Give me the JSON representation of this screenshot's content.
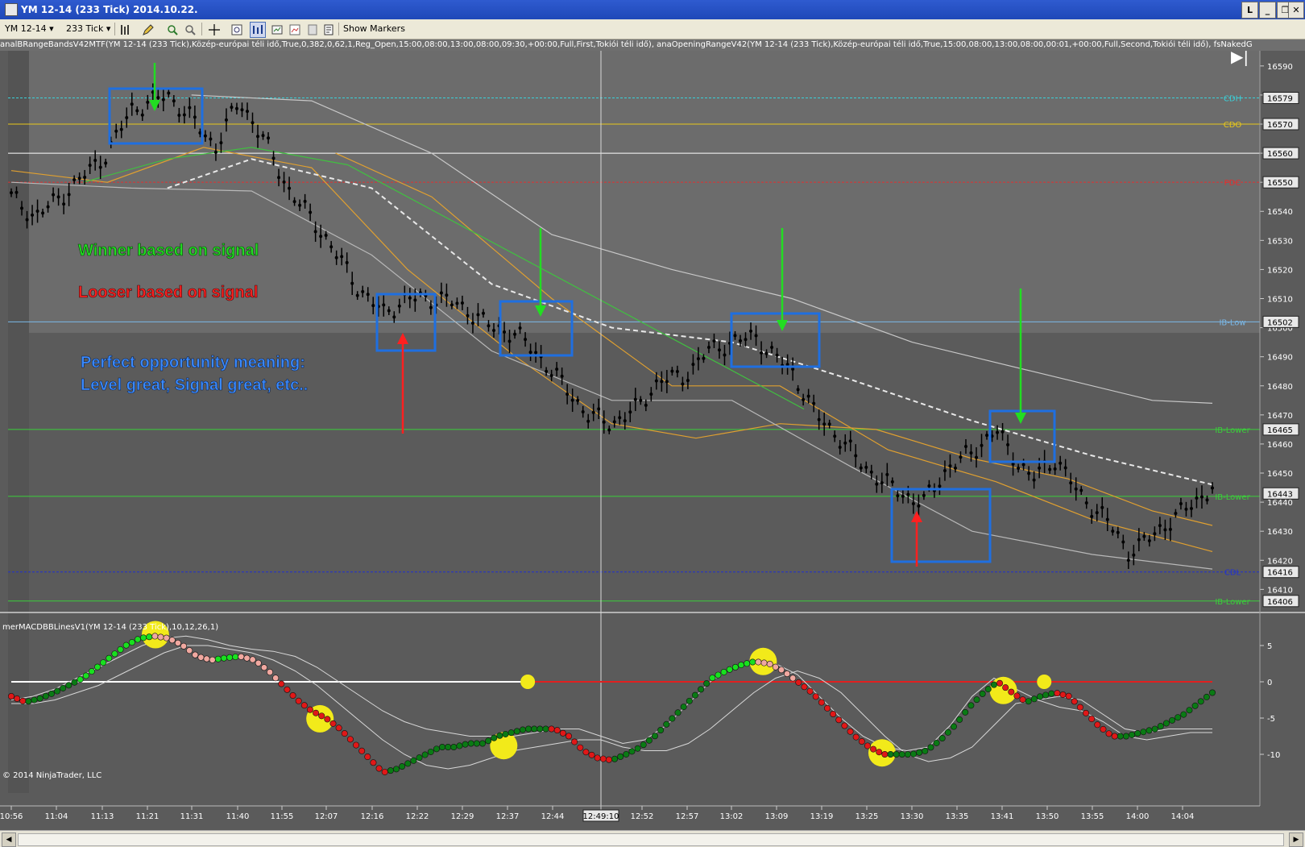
{
  "window": {
    "title": "YM 12-14 (233 Tick)  2014.10.22.",
    "buttons": [
      "L",
      "_",
      "❐",
      "✕"
    ]
  },
  "toolbar": {
    "instrument": "YM 12-14",
    "interval": "233 Tick",
    "show_markers": "Show Markers"
  },
  "indicator_text": "analBRangeBandsV42MTF(YM 12-14 (233 Tick),Közép-európai téli idő,True,0,382,0,62,1,Reg_Open,15:00,08:00,13:00,08:00,09:30,+00:00,Full,First,Tokiói téli idő), anaOpeningRangeV42(YM 12-14 (233 Tick),Közép-európai téli idő,True,15:00,08:00,13:00,08:00,00:01,+00:00,Full,Second,Tokiói téli idő), fsNakedG",
  "macd_label": "merMACDBBLinesV1(YM 12-14 (233 Tick),10,12,26,1)",
  "copyright": "© 2014 NinjaTrader, LLC",
  "annotations": {
    "winner": "Winner based on signal",
    "looser": "Looser based on signal",
    "perfect_line1": "Perfect opportunity meaning:",
    "perfect_line2": "Level great, Signal great, etc.."
  },
  "colors": {
    "winner": "#22dd22",
    "looser": "#ff2020",
    "perfect": "#3a8aff",
    "box": "#1f6fe0"
  },
  "chart_data": {
    "type": "line",
    "price_panel": {
      "y_ticks": [
        16590,
        16580,
        16570,
        16560,
        16550,
        16540,
        16530,
        16520,
        16510,
        16500,
        16490,
        16480,
        16470,
        16460,
        16450,
        16440,
        16430,
        16420,
        16410
      ],
      "ylim": [
        16404,
        16593
      ],
      "price_tags": [
        16579,
        16570,
        16560,
        16550,
        16502,
        16465,
        16443,
        16416,
        16406
      ],
      "levels": [
        {
          "label": "CDH",
          "value": 16579,
          "color": "#3ad0d8",
          "dash": true
        },
        {
          "label": "CDO",
          "value": 16570,
          "color": "#e8c81a",
          "dash": false
        },
        {
          "label": "",
          "value": 16560,
          "color": "#ffffff",
          "dash": false
        },
        {
          "label": "PDC",
          "value": 16550,
          "color": "#e03030",
          "dash": true
        },
        {
          "label": "IB-Low",
          "value": 16502,
          "color": "#7ab8e8",
          "dash": false
        },
        {
          "label": "IB-Lower",
          "value": 16465,
          "color": "#3ad03a",
          "dash": false
        },
        {
          "label": "IB-Lower",
          "value": 16442,
          "color": "#3ad03a",
          "dash": false
        },
        {
          "label": "CDL",
          "value": 16416,
          "color": "#2030d0",
          "dash": true
        },
        {
          "label": "IB-Lower",
          "value": 16406,
          "color": "#3ad03a",
          "dash": false
        }
      ],
      "close_path": [
        [
          0.0,
          16545
        ],
        [
          0.02,
          16538
        ],
        [
          0.05,
          16548
        ],
        [
          0.08,
          16560
        ],
        [
          0.1,
          16575
        ],
        [
          0.13,
          16580
        ],
        [
          0.15,
          16572
        ],
        [
          0.17,
          16562
        ],
        [
          0.19,
          16578
        ],
        [
          0.21,
          16565
        ],
        [
          0.23,
          16548
        ],
        [
          0.26,
          16532
        ],
        [
          0.29,
          16513
        ],
        [
          0.31,
          16505
        ],
        [
          0.33,
          16510
        ],
        [
          0.36,
          16510
        ],
        [
          0.38,
          16506
        ],
        [
          0.4,
          16500
        ],
        [
          0.42,
          16498
        ],
        [
          0.44,
          16490
        ],
        [
          0.46,
          16480
        ],
        [
          0.48,
          16470
        ],
        [
          0.5,
          16467
        ],
        [
          0.52,
          16472
        ],
        [
          0.54,
          16482
        ],
        [
          0.56,
          16483
        ],
        [
          0.58,
          16492
        ],
        [
          0.6,
          16495
        ],
        [
          0.62,
          16497
        ],
        [
          0.63,
          16492
        ],
        [
          0.65,
          16485
        ],
        [
          0.67,
          16470
        ],
        [
          0.69,
          16462
        ],
        [
          0.71,
          16452
        ],
        [
          0.73,
          16446
        ],
        [
          0.75,
          16441
        ],
        [
          0.76,
          16440
        ],
        [
          0.78,
          16452
        ],
        [
          0.8,
          16457
        ],
        [
          0.82,
          16465
        ],
        [
          0.83,
          16458
        ],
        [
          0.85,
          16448
        ],
        [
          0.87,
          16455
        ],
        [
          0.89,
          16442
        ],
        [
          0.91,
          16435
        ],
        [
          0.93,
          16423
        ],
        [
          0.94,
          16425
        ],
        [
          0.96,
          16432
        ],
        [
          0.97,
          16435
        ],
        [
          1.0,
          16445
        ]
      ],
      "moving_averages": [
        {
          "color": "#e0a030",
          "points": [
            [
              0.0,
              16554
            ],
            [
              0.08,
              16550
            ],
            [
              0.16,
              16562
            ],
            [
              0.25,
              16555
            ],
            [
              0.33,
              16520
            ],
            [
              0.42,
              16490
            ],
            [
              0.5,
              16467
            ],
            [
              0.57,
              16462
            ],
            [
              0.64,
              16467
            ],
            [
              0.72,
              16465
            ],
            [
              0.8,
              16455
            ],
            [
              0.88,
              16448
            ],
            [
              0.95,
              16437
            ],
            [
              1.0,
              16432
            ]
          ]
        },
        {
          "color": "#e0a030",
          "points": [
            [
              0.27,
              16560
            ],
            [
              0.35,
              16545
            ],
            [
              0.45,
              16510
            ],
            [
              0.55,
              16480
            ],
            [
              0.64,
              16480
            ],
            [
              0.73,
              16458
            ],
            [
              0.82,
              16447
            ],
            [
              0.9,
              16434
            ],
            [
              1.0,
              16423
            ]
          ]
        },
        {
          "color": "#e8e8e8",
          "dash": true,
          "points": [
            [
              0.13,
              16548
            ],
            [
              0.2,
              16558
            ],
            [
              0.3,
              16548
            ],
            [
              0.4,
              16515
            ],
            [
              0.5,
              16500
            ],
            [
              0.6,
              16495
            ],
            [
              0.7,
              16482
            ],
            [
              0.8,
              16468
            ],
            [
              0.9,
              16456
            ],
            [
              1.0,
              16446
            ]
          ]
        },
        {
          "color": "#c8c8c8",
          "points": [
            [
              0.15,
              16580
            ],
            [
              0.25,
              16578
            ],
            [
              0.35,
              16560
            ],
            [
              0.45,
              16532
            ],
            [
              0.55,
              16520
            ],
            [
              0.65,
              16510
            ],
            [
              0.75,
              16495
            ],
            [
              0.85,
              16485
            ],
            [
              0.95,
              16475
            ],
            [
              1.0,
              16474
            ]
          ]
        },
        {
          "color": "#b8b8b8",
          "points": [
            [
              0.0,
              16550
            ],
            [
              0.1,
              16548
            ],
            [
              0.2,
              16547
            ],
            [
              0.3,
              16525
            ],
            [
              0.4,
              16492
            ],
            [
              0.5,
              16475
            ],
            [
              0.6,
              16475
            ],
            [
              0.7,
              16452
            ],
            [
              0.8,
              16430
            ],
            [
              0.9,
              16422
            ],
            [
              1.0,
              16417
            ]
          ]
        },
        {
          "color": "#40c040",
          "points": [
            [
              0.06,
              16550
            ],
            [
              0.13,
              16558
            ],
            [
              0.2,
              16562
            ],
            [
              0.28,
              16556
            ],
            [
              0.66,
              16472
            ]
          ]
        }
      ]
    },
    "macd_panel": {
      "y_ticks": [
        5,
        0,
        -5,
        -10
      ],
      "ylim": [
        -13,
        7
      ],
      "values": [
        -2,
        -2.8,
        -2.3,
        -1.5,
        -0.5,
        0.5,
        2,
        3.5,
        5,
        6,
        6.3,
        6,
        5,
        3.5,
        3,
        3.3,
        3.5,
        3,
        1.5,
        -0.5,
        -2.5,
        -4,
        -5,
        -6.5,
        -8.5,
        -10.5,
        -12.5,
        -12,
        -11,
        -10,
        -9,
        -9,
        -8.5,
        -8.5,
        -7.5,
        -7,
        -6.5,
        -6.5,
        -6.5,
        -7.5,
        -9.5,
        -10.5,
        -10.8,
        -10,
        -9,
        -7.5,
        -5.5,
        -3.5,
        -1.5,
        0.5,
        1.5,
        2.3,
        2.8,
        2.5,
        1.5,
        0,
        -1.5,
        -3.5,
        -5.5,
        -7.5,
        -9,
        -10,
        -10,
        -10,
        -9.5,
        -8,
        -6,
        -3.5,
        -1.5,
        0,
        -1.5,
        -2.8,
        -2,
        -1.5,
        -2,
        -4,
        -6,
        -7.5,
        -7.5,
        -7,
        -6.5,
        -5.5,
        -4.5,
        -3,
        -1.5
      ],
      "band_upper": [
        -2.5,
        -2,
        -1,
        0.5,
        2,
        3.5,
        5,
        6,
        6.3,
        5.8,
        5,
        4.5,
        4.2,
        3.5,
        2,
        0,
        -2,
        -4,
        -5.5,
        -6.5,
        -7,
        -7.5,
        -7.5,
        -7.5,
        -7,
        -6.5,
        -6.5,
        -7.5,
        -8.5,
        -8,
        -6,
        -3,
        0,
        2,
        3,
        2.5,
        1,
        -2,
        -5,
        -7.5,
        -9,
        -9.5,
        -9,
        -6,
        -2,
        0.5,
        -1,
        -2.5,
        -2,
        -2.5,
        -4.5,
        -6.5,
        -7,
        -6.5,
        -6.5,
        -6.5
      ],
      "band_lower": [
        -3,
        -3,
        -2.5,
        -1.5,
        -0.5,
        1,
        2.5,
        4,
        5,
        5,
        4.5,
        4,
        3,
        1.5,
        -0.5,
        -3,
        -5.5,
        -8,
        -10,
        -11.5,
        -12,
        -11.5,
        -10.5,
        -9.5,
        -9,
        -8.5,
        -8,
        -8,
        -9,
        -9.5,
        -9.5,
        -8.5,
        -6.5,
        -4,
        -1.5,
        0.5,
        1.5,
        0.5,
        -1.5,
        -4.5,
        -7.5,
        -10,
        -11,
        -10.5,
        -9,
        -6,
        -3,
        -2.5,
        -3.5,
        -4,
        -5.5,
        -7.5,
        -8,
        -7.5,
        -7,
        -7
      ],
      "markers": [
        [
          0.12,
          6.5
        ],
        [
          0.257,
          -5.1
        ],
        [
          0.41,
          -8.8
        ],
        [
          0.626,
          2.8
        ],
        [
          0.725,
          -9.8
        ],
        [
          0.826,
          -1.2
        ]
      ],
      "zero_markers": [
        0.43,
        0.86
      ]
    },
    "time_labels": [
      "10:56",
      "11:04",
      "11:13",
      "11:21",
      "11:31",
      "11:40",
      "11:55",
      "12:07",
      "12:16",
      "12:22",
      "12:29",
      "12:37",
      "12:44",
      "12:49:10",
      "12:52",
      "12:57",
      "13:02",
      "13:09",
      "13:19",
      "13:25",
      "13:30",
      "13:35",
      "13:41",
      "13:50",
      "13:55",
      "14:00",
      "14:04"
    ]
  }
}
